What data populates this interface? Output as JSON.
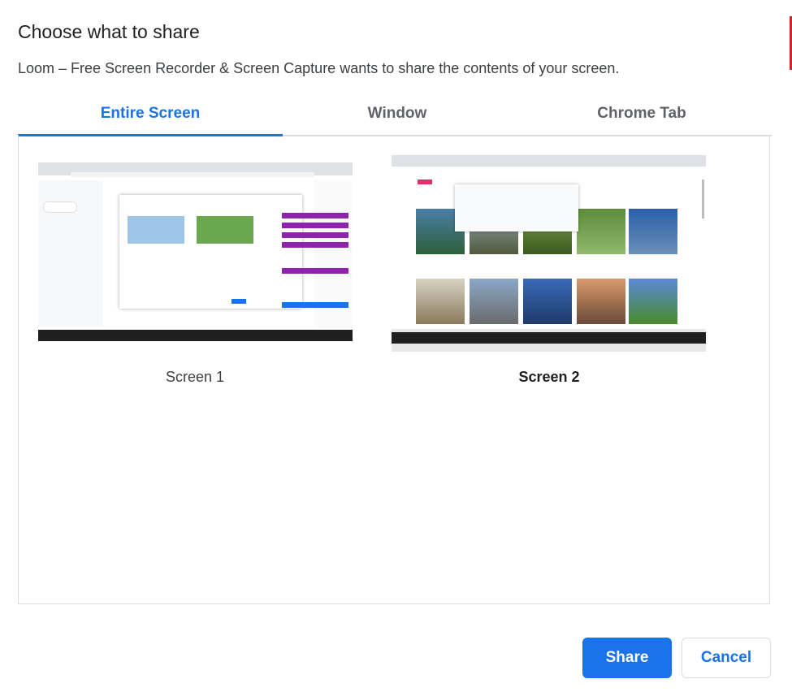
{
  "dialog": {
    "title": "Choose what to share",
    "subtitle": "Loom – Free Screen Recorder & Screen Capture wants to share the contents of your screen."
  },
  "tabs": [
    {
      "label": "Entire Screen",
      "active": true
    },
    {
      "label": "Window",
      "active": false
    },
    {
      "label": "Chrome Tab",
      "active": false
    }
  ],
  "screens": [
    {
      "label": "Screen 1",
      "selected": false
    },
    {
      "label": "Screen 2",
      "selected": true
    }
  ],
  "buttons": {
    "share_label": "Share",
    "cancel_label": "Cancel"
  },
  "colors": {
    "accent": "#1a73e8",
    "border": "#dadce0"
  }
}
